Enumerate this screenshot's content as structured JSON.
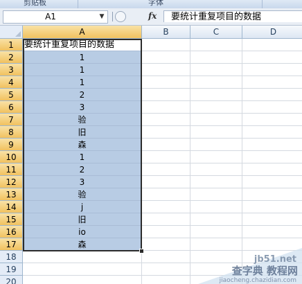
{
  "ribbon": {
    "group_clipboard": "剪贴板",
    "group_font": "字体"
  },
  "formula_bar": {
    "name_box": "A1",
    "fx_label": "fx",
    "formula": "要统计重复项目的数据",
    "name_box_dropdown_icon": "chevron-down-icon",
    "circle_icon": "circle-icon"
  },
  "grid": {
    "columns": [
      "A",
      "B",
      "C",
      "D"
    ],
    "rows": [
      "1",
      "2",
      "3",
      "4",
      "5",
      "6",
      "7",
      "8",
      "9",
      "10",
      "11",
      "12",
      "13",
      "14",
      "15",
      "16",
      "17",
      "18",
      "19",
      "20"
    ],
    "column_a_values": [
      "要统计重复项目的数据",
      "1",
      "1",
      "1",
      "2",
      "3",
      "验",
      "旧",
      "森",
      "1",
      "2",
      "3",
      "验",
      "j",
      "旧",
      "io",
      "森"
    ],
    "selected_range": "A1:A17",
    "active_cell": "A1"
  },
  "colors": {
    "selection_fill": "#b8cce4",
    "header_selected": "#f1c15f",
    "header_normal": "#e4ecf7"
  },
  "watermark": {
    "site": "jb51.net",
    "main": "查字典 教程网",
    "sub": "jiaocheng.chazidian.com"
  }
}
